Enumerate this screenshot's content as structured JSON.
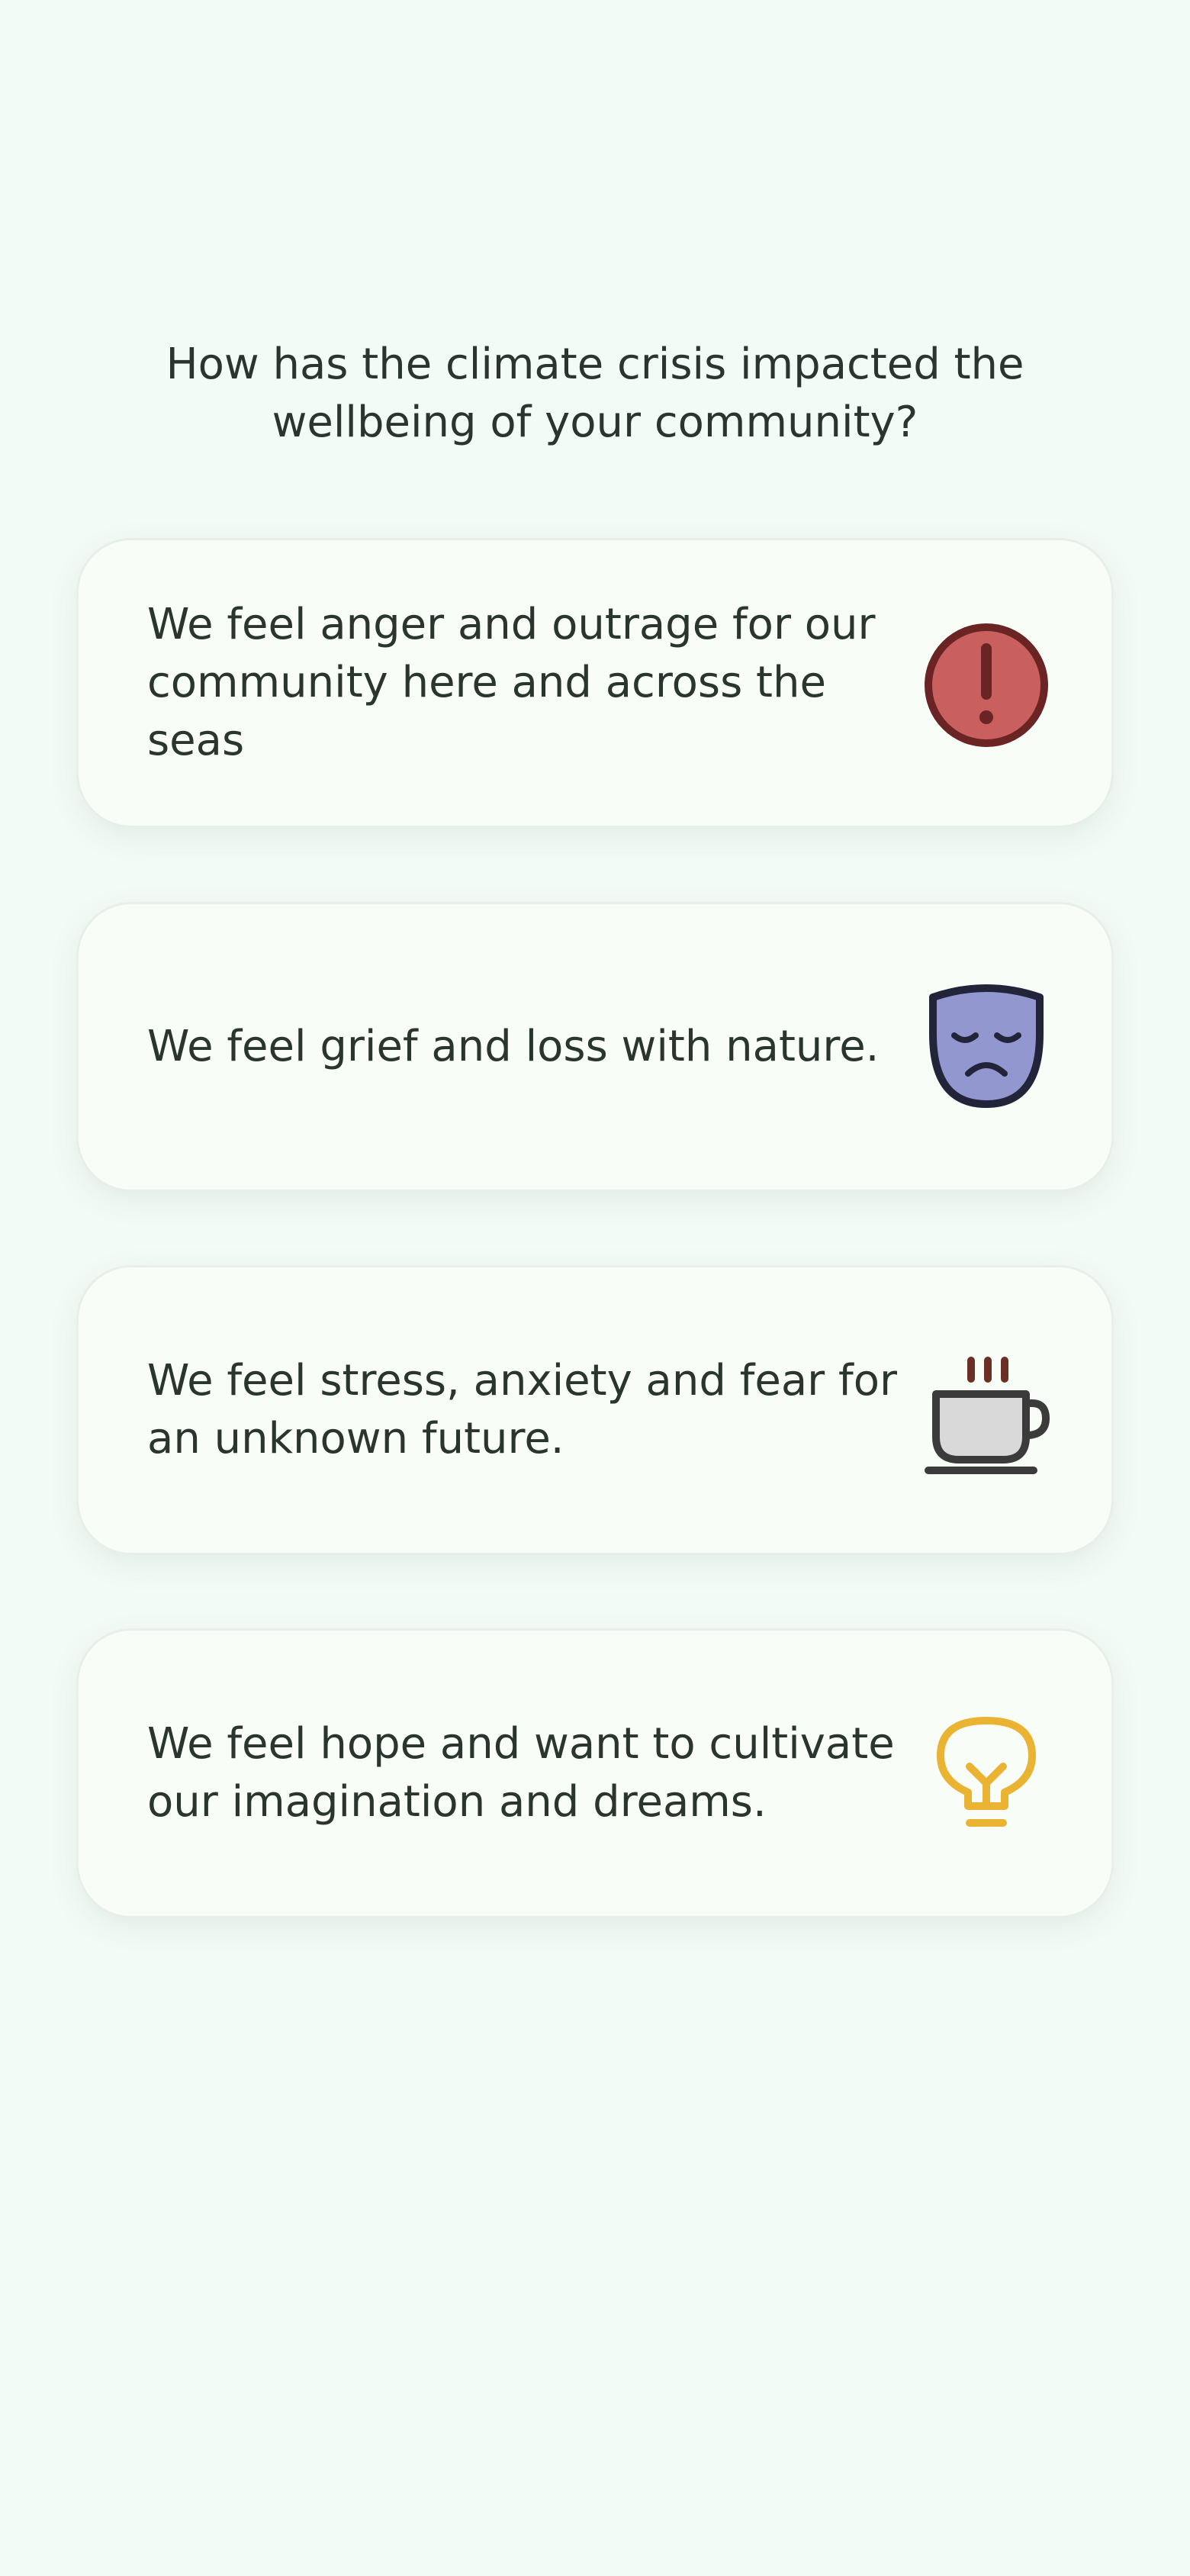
{
  "question": "How has the climate crisis impacted the wellbeing of your community?",
  "options": [
    {
      "label": "We feel anger and outrage for our community here and across the seas",
      "icon": "alert-icon",
      "color": "#c9605f"
    },
    {
      "label": "We feel grief and loss with nature.",
      "icon": "sad-mask-icon",
      "color": "#9297cf"
    },
    {
      "label": "We feel stress, anxiety and fear for an unknown future.",
      "icon": "steaming-cup-icon",
      "color": "#d9d9d9"
    },
    {
      "label": "We feel hope and want to cultivate our imagination and dreams.",
      "icon": "lightbulb-icon",
      "color": "#eab332"
    }
  ]
}
